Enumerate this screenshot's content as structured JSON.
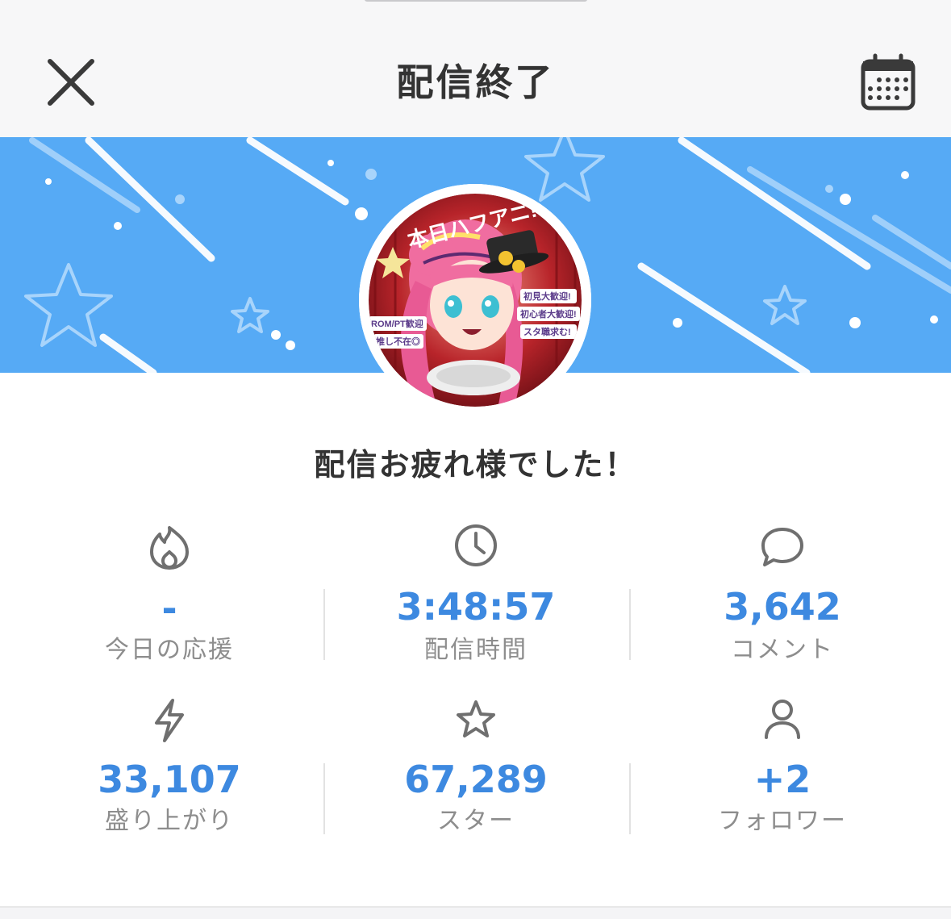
{
  "header": {
    "title": "配信終了",
    "close_icon": "close-icon",
    "calendar_icon": "calendar-icon"
  },
  "banner": {
    "background_color": "#56aaf5"
  },
  "avatar": {
    "image_text": "本日ハフアニ!!",
    "badge_lines": [
      "初見大歓迎!",
      "初心者大歓迎!",
      "スタ職求む!"
    ],
    "left_lines": [
      "ROM/PT歓迎",
      "推し不在◎"
    ]
  },
  "message": "配信お疲れ様でした！",
  "stats": [
    {
      "icon": "flame-icon",
      "value": "-",
      "label": "今日の応援"
    },
    {
      "icon": "clock-icon",
      "value": "3:48:57",
      "label": "配信時間"
    },
    {
      "icon": "comment-icon",
      "value": "3,642",
      "label": "コメント"
    },
    {
      "icon": "lightning-icon",
      "value": "33,107",
      "label": "盛り上がり"
    },
    {
      "icon": "star-icon",
      "value": "67,289",
      "label": "スター"
    },
    {
      "icon": "person-icon",
      "value": "+2",
      "label": "フォロワー"
    }
  ],
  "colors": {
    "accent": "#3d89e0",
    "title_text": "#333333",
    "label_text": "#8d8d8d"
  }
}
